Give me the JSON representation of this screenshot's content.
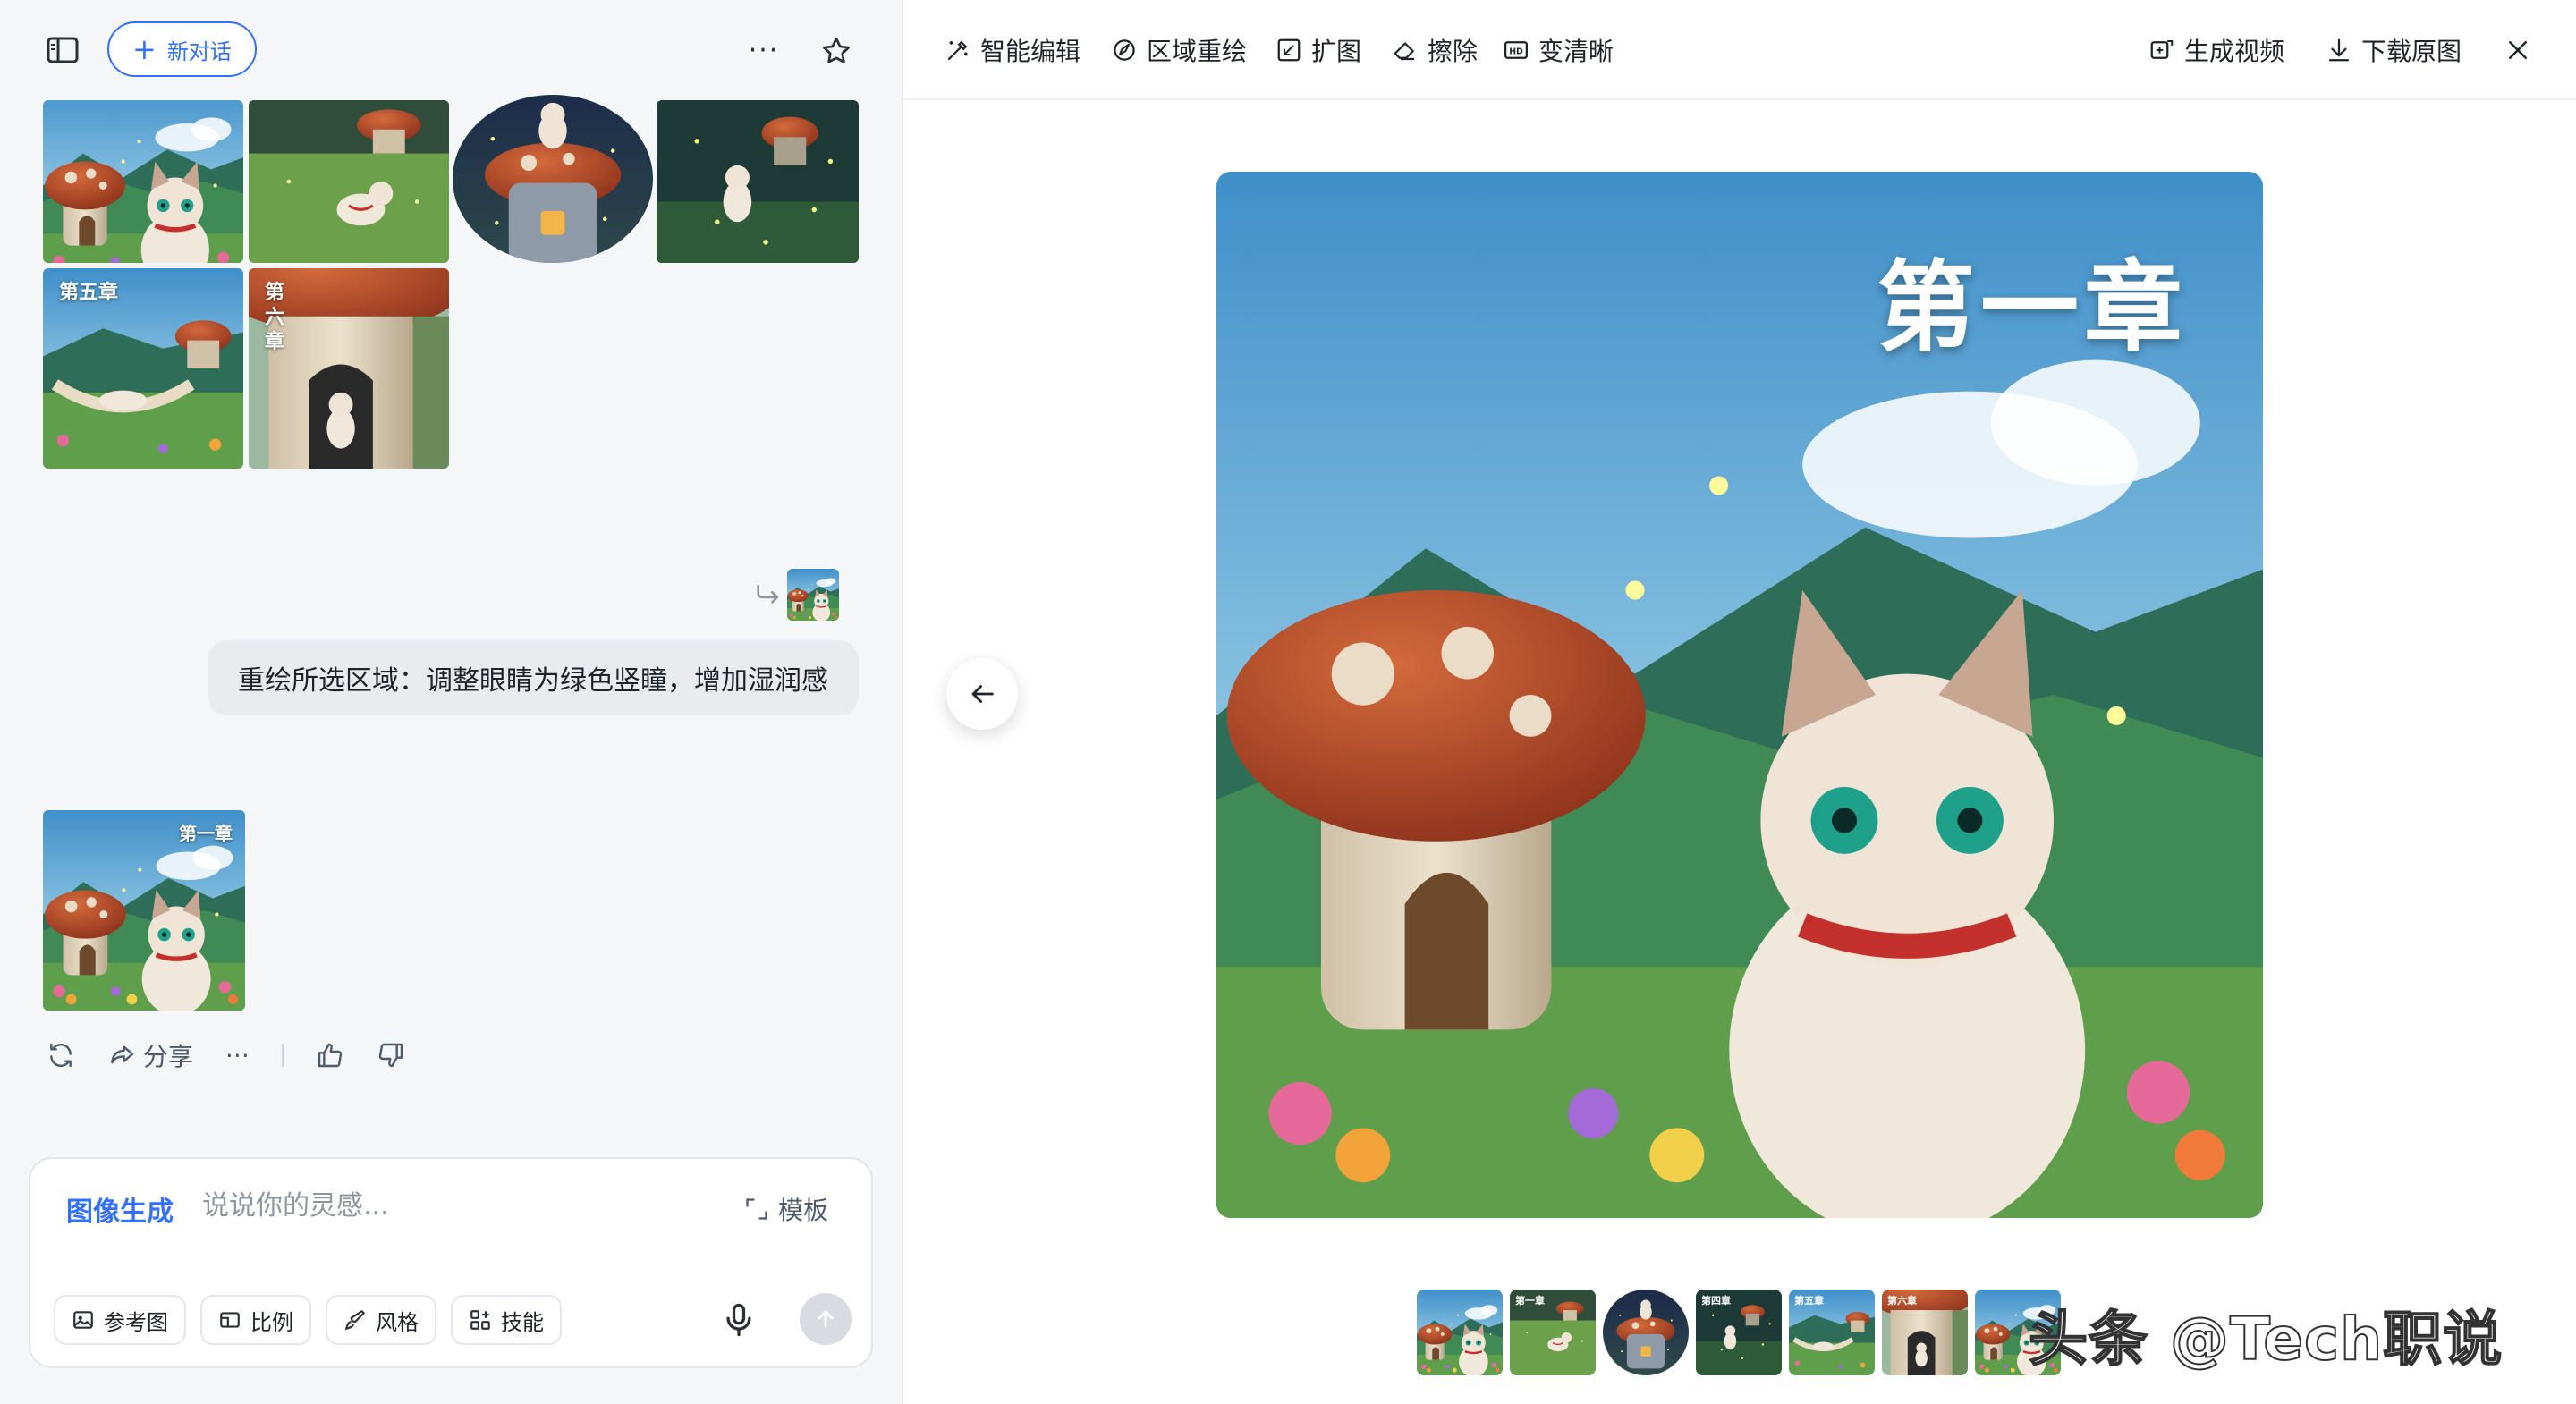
{
  "left_panel": {
    "new_chat_label": "新对话",
    "more_label": "···",
    "gallery": [
      {
        "label": ""
      },
      {
        "label": ""
      },
      {
        "label": ""
      },
      {
        "label": ""
      },
      {
        "label": "第五章"
      },
      {
        "label": "第六章"
      }
    ],
    "user_message": "重绘所选区域：调整眼睛为绿色竖瞳，增加湿润感",
    "result_label": "第一章",
    "actions": {
      "share_label": "分享",
      "more_label": "···"
    },
    "composer": {
      "mode_label": "图像生成",
      "placeholder": "说说你的灵感...",
      "template_label": "模板",
      "chips": [
        "参考图",
        "比例",
        "风格",
        "技能"
      ]
    }
  },
  "right_panel": {
    "toolbar": {
      "smart_edit": "智能编辑",
      "region_repaint": "区域重绘",
      "expand": "扩图",
      "erase": "擦除",
      "enhance": "变清晰",
      "generate_video": "生成视频",
      "download": "下载原图"
    },
    "main_image_label": "第一章",
    "strip": [
      {
        "label": ""
      },
      {
        "label": "第一章"
      },
      {
        "label": ""
      },
      {
        "label": "第四章"
      },
      {
        "label": "第五章"
      },
      {
        "label": "第六章"
      },
      {
        "label": ""
      }
    ],
    "watermark": "头条 @Tech职说"
  },
  "colors": {
    "accent": "#3370ff",
    "left_bg": "#f5f6f8",
    "bubble_bg": "#e9ebef"
  }
}
